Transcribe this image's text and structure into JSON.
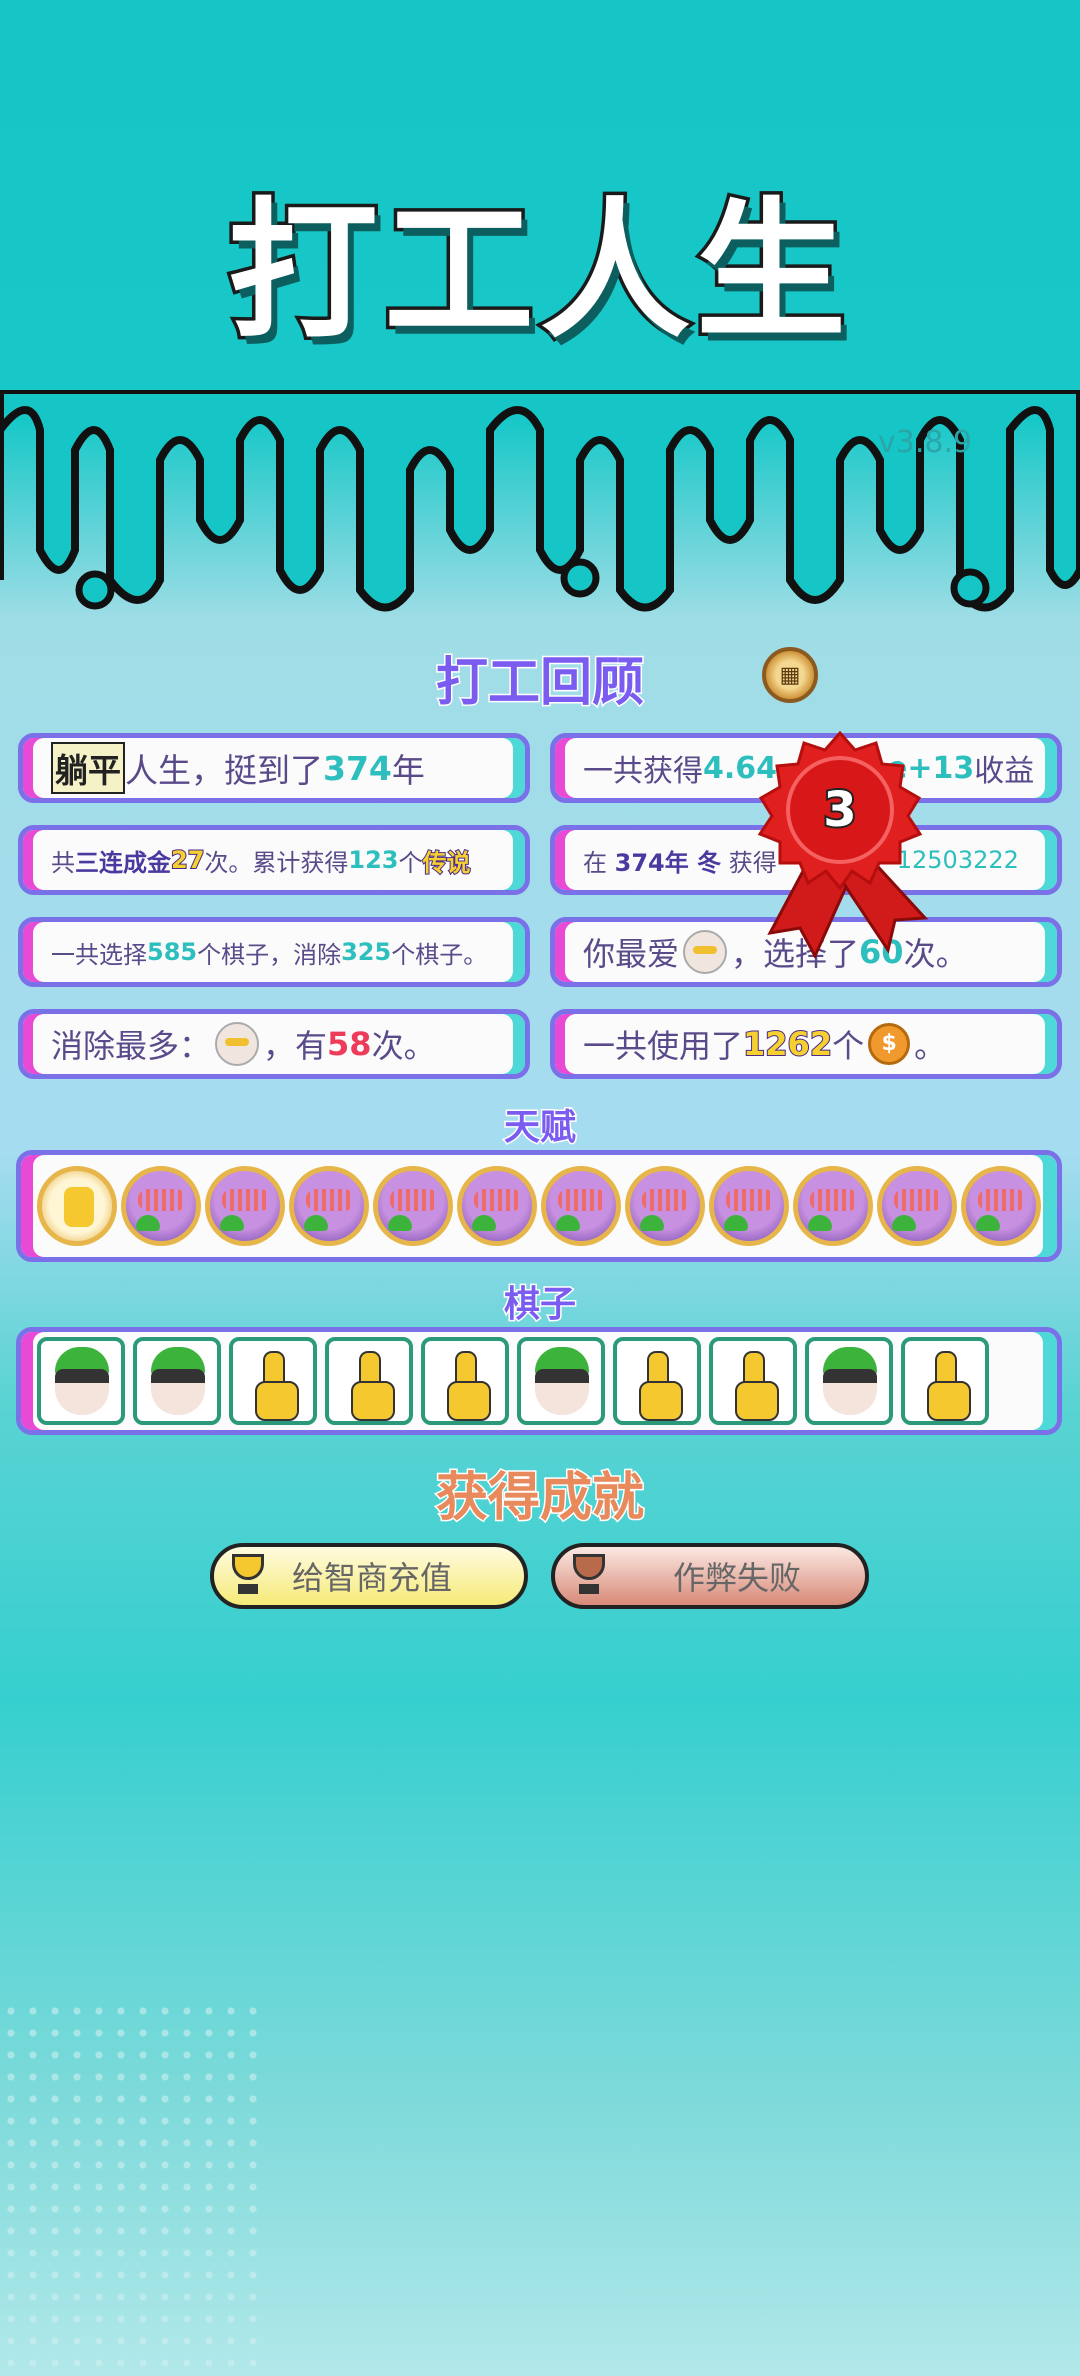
{
  "title": "打工人生",
  "version": "v3.8.9",
  "review_title": "打工回顾",
  "coin_button_icon": "bar-chart-coin-icon",
  "stats": {
    "r1_left": {
      "badge": "躺平",
      "pre": "人生，挺到了",
      "num": "374",
      "post": "年"
    },
    "r1_right": {
      "pre": "一共获得",
      "num": "4.64",
      "mid": "e",
      "num2": "+13",
      "post": "收益"
    },
    "r2_left": {
      "pre": "共",
      "em": "三连成金",
      "num": "27",
      "mid": "次。累计获得",
      "num2": "123",
      "mid2": "个",
      "tag": "传说"
    },
    "r2_right": {
      "pre": "在",
      "em": "374年 冬",
      "mid": "获得",
      "num": "12503222"
    },
    "r3_left": {
      "pre": "一共选择",
      "num": "585",
      "mid": "个棋子，消除",
      "num2": "325",
      "post": "个棋子。"
    },
    "r3_right": {
      "pre": "你最爱",
      "mid": "，选择了",
      "num": "60",
      "post": "次。"
    },
    "r4_left": {
      "pre": "消除最多：",
      "mid": "，有",
      "num": "58",
      "post": "次。"
    },
    "r4_right": {
      "pre": "一共使用了",
      "num": "1262",
      "mid": "个",
      "coin": "$",
      "post": "。"
    }
  },
  "medal": {
    "rank": "3"
  },
  "talent_title": "天赋",
  "piece_title": "棋子",
  "achievements_title": "获得成就",
  "achievements": [
    {
      "label": "给智商充值",
      "tier": "gold"
    },
    {
      "label": "作弊失败",
      "tier": "bronze"
    }
  ],
  "colors": {
    "accent": "#7b5cf0",
    "teal": "#2dbebe",
    "pink": "#e84ad6",
    "red_medal": "#e0201e"
  }
}
